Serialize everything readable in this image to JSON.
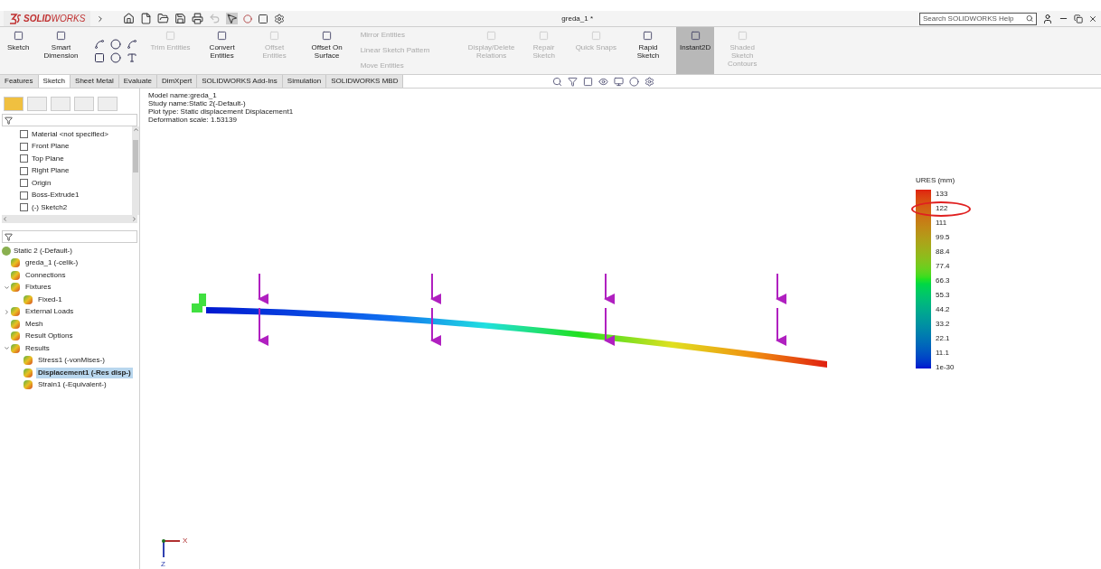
{
  "app": {
    "logo": "**SOLID**WORKS",
    "document_title": "greda_1 *",
    "help_search": {
      "placeholder": "Search SOLIDWORKS Help"
    }
  },
  "ribbon": [
    {
      "label": "Sketch",
      "disabled": false,
      "selected": false
    },
    {
      "label": "Smart Dimension",
      "disabled": false,
      "selected": false
    },
    {
      "label": "Trim Entities",
      "disabled": true,
      "selected": false
    },
    {
      "label": "Convert Entities",
      "disabled": false,
      "selected": false
    },
    {
      "label": "Offset Entities",
      "disabled": true,
      "selected": false
    },
    {
      "label": "Offset On Surface",
      "disabled": false,
      "selected": false
    },
    {
      "label": "Display/Delete Relations",
      "disabled": true,
      "selected": false
    },
    {
      "label": "Repair Sketch",
      "disabled": true,
      "selected": false
    },
    {
      "label": "Quick Snaps",
      "disabled": true,
      "selected": false
    },
    {
      "label": "Rapid Sketch",
      "disabled": false,
      "selected": false
    },
    {
      "label": "Instant2D",
      "disabled": false,
      "selected": true
    },
    {
      "label": "Shaded Sketch Contours",
      "disabled": true,
      "selected": false
    }
  ],
  "ribbon_list": [
    {
      "label": "Mirror Entities",
      "disabled": true
    },
    {
      "label": "Linear Sketch Pattern",
      "disabled": true
    },
    {
      "label": "Move Entities",
      "disabled": true
    }
  ],
  "tabs": [
    {
      "label": "Features",
      "selected": false
    },
    {
      "label": "Sketch",
      "selected": true
    },
    {
      "label": "Sheet Metal",
      "selected": false
    },
    {
      "label": "Evaluate",
      "selected": false
    },
    {
      "label": "DimXpert",
      "selected": false
    },
    {
      "label": "SOLIDWORKS Add-Ins",
      "selected": false
    },
    {
      "label": "Simulation",
      "selected": false
    },
    {
      "label": "SOLIDWORKS MBD",
      "selected": false
    }
  ],
  "feature_tree": [
    "Material <not specified>",
    "Front Plane",
    "Top Plane",
    "Right Plane",
    "Origin",
    "Boss-Extrude1",
    "(-) Sketch2"
  ],
  "study_tree": {
    "label": "Static 2 (-Default-)",
    "children": [
      {
        "label": "greda_1 (-celik-)",
        "selected": false
      },
      {
        "label": "Connections",
        "selected": false
      },
      {
        "label": "Fixtures",
        "selected": false,
        "expanded": true,
        "children": [
          {
            "label": "Fixed-1",
            "selected": false
          }
        ]
      },
      {
        "label": "External Loads",
        "selected": false,
        "expanded": false
      },
      {
        "label": "Mesh",
        "selected": false
      },
      {
        "label": "Result Options",
        "selected": false
      },
      {
        "label": "Results",
        "selected": false,
        "expanded": true,
        "children": [
          {
            "label": "Stress1 (-vonMises-)",
            "selected": false
          },
          {
            "label": "Displacement1 (-Res disp-)",
            "selected": true
          },
          {
            "label": "Strain1 (-Equivalent-)",
            "selected": false
          }
        ]
      }
    ]
  },
  "plot_info": [
    "Model name:greda_1",
    "Study name:Static 2(-Default-)",
    "Plot type: Static displacement Displacement1",
    "Deformation scale: 1.53139"
  ],
  "legend": {
    "title": "URES (mm)",
    "ticks": [
      "133",
      "122",
      "111",
      "99.5",
      "88.4",
      "77.4",
      "66.3",
      "55.3",
      "44.2",
      "33.2",
      "22.1",
      "11.1",
      "1e-30"
    ]
  },
  "triad": {
    "x": "X",
    "z": "Z"
  }
}
